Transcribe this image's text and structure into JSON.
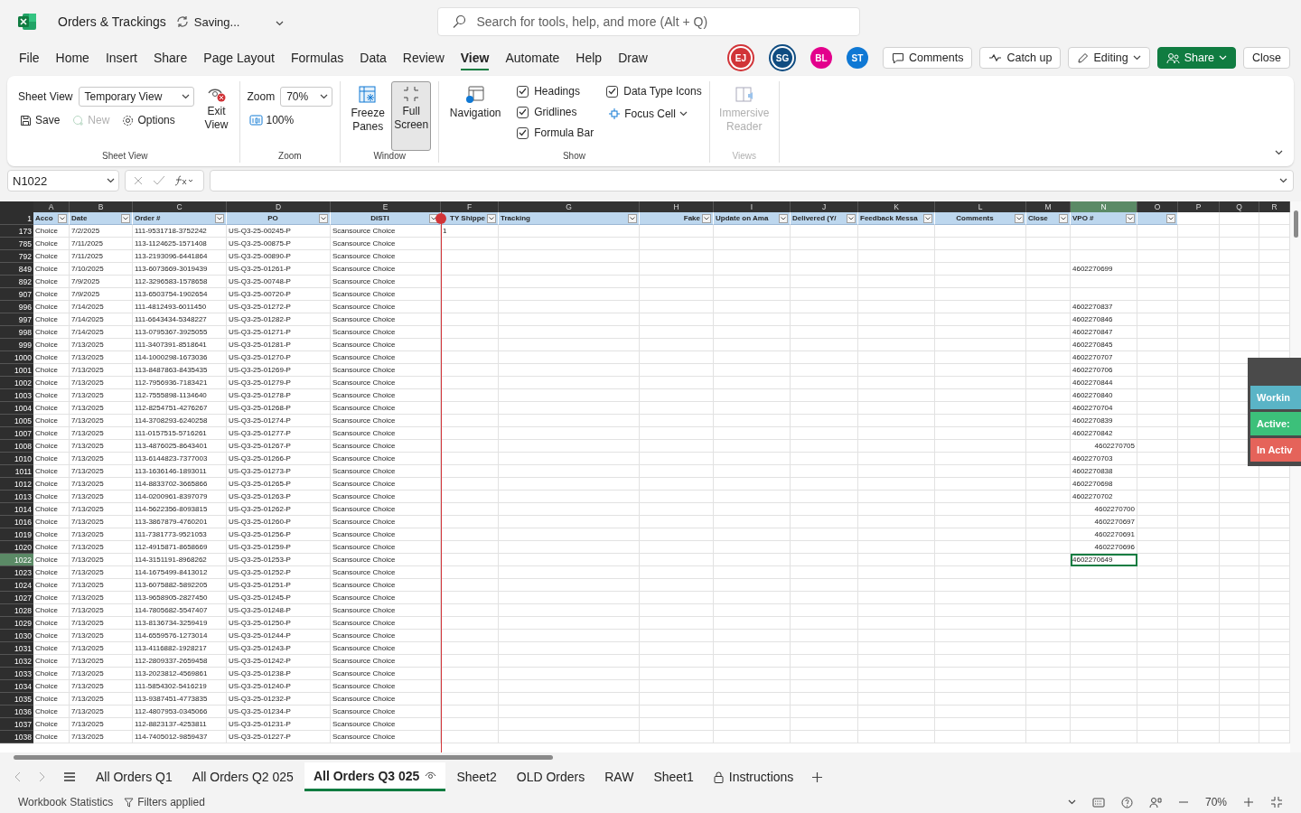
{
  "title_bar": {
    "file_name": "Orders & Trackings",
    "save_status": "Saving...",
    "search": {
      "placeholder": "Search for tools, help, and more (Alt + Q)"
    }
  },
  "menu": {
    "tabs": [
      {
        "label": "File",
        "selected": false
      },
      {
        "label": "Home",
        "selected": false
      },
      {
        "label": "Insert",
        "selected": false
      },
      {
        "label": "Share",
        "selected": false
      },
      {
        "label": "Page Layout",
        "selected": false
      },
      {
        "label": "Formulas",
        "selected": false
      },
      {
        "label": "Data",
        "selected": false
      },
      {
        "label": "Review",
        "selected": false
      },
      {
        "label": "View",
        "selected": true
      },
      {
        "label": "Automate",
        "selected": false
      },
      {
        "label": "Help",
        "selected": false
      },
      {
        "label": "Draw",
        "selected": false
      }
    ],
    "avatars": [
      {
        "initials": "EJ",
        "color": "#d13438",
        "ring": true
      },
      {
        "initials": "SG",
        "color": "#0f4c81",
        "ring": true
      },
      {
        "initials": "BL",
        "color": "#e3008c",
        "ring": false
      },
      {
        "initials": "ST",
        "color": "#0f78d4",
        "ring": false
      }
    ],
    "buttons": [
      {
        "label": "Comments",
        "kind": "comments"
      },
      {
        "label": "Catch up",
        "kind": "catchup"
      },
      {
        "label": "Editing",
        "kind": "editing"
      },
      {
        "label": "Share",
        "kind": "share"
      },
      {
        "label": "Close",
        "kind": "close"
      }
    ]
  },
  "ribbon": {
    "sheet_view": {
      "label": "Sheet View",
      "view": "Temporary View",
      "save": "Save",
      "new": {
        "label": "New",
        "disabled": true
      },
      "options": "Options",
      "exit": "Exit View",
      "group": "Sheet View"
    },
    "zoom": {
      "label": "Zoom",
      "value": "70%",
      "reset": "100%",
      "group": "Zoom"
    },
    "window": {
      "freeze": "Freeze Panes",
      "full_screen": {
        "label": "Full Screen",
        "selected": true
      },
      "group": "Window"
    },
    "show": {
      "navigation": "Navigation",
      "checks": [
        {
          "label": "Headings",
          "checked": true
        },
        {
          "label": "Gridlines",
          "checked": true
        },
        {
          "label": "Formula Bar",
          "checked": true
        },
        {
          "label": "Data Type Icons",
          "checked": true
        }
      ],
      "focus_cell": "Focus Cell",
      "group": "Show"
    },
    "views": {
      "immersive": {
        "label": "Immersive Reader",
        "disabled": true
      },
      "group": "Views"
    }
  },
  "formula_bar": {
    "name_box": "N1022"
  },
  "sheet": {
    "columns": [
      {
        "letter": "A",
        "header": "Acco",
        "filter": true,
        "selected": false
      },
      {
        "letter": "B",
        "header": "Date",
        "filter": true,
        "selected": false
      },
      {
        "letter": "C",
        "header": "Order #",
        "filter": true,
        "selected": false
      },
      {
        "letter": "D",
        "header": "PO",
        "filter": true,
        "selected": false
      },
      {
        "letter": "E",
        "header": "DISTI",
        "filter": true,
        "selected": false
      },
      {
        "letter": "F",
        "header": "TY Shippe",
        "filter": true,
        "selected": false,
        "color": "#d13438"
      },
      {
        "letter": "G",
        "header": "Tracking",
        "filter": true,
        "selected": false
      },
      {
        "letter": "H",
        "header": "Fake",
        "filter": true,
        "selected": false
      },
      {
        "letter": "I",
        "header": "Update on Ama",
        "filter": true,
        "selected": false
      },
      {
        "letter": "J",
        "header": "Delivered (Y/",
        "filter": true,
        "selected": false
      },
      {
        "letter": "K",
        "header": "Feedback Messa",
        "filter": true,
        "selected": false
      },
      {
        "letter": "L",
        "header": "Comments",
        "filter": true,
        "selected": false
      },
      {
        "letter": "M",
        "header": "Close",
        "filter": true,
        "selected": false
      },
      {
        "letter": "N",
        "header": "VPO #",
        "filter": true,
        "selected": true
      },
      {
        "letter": "O",
        "filter": true,
        "selected": false
      },
      {
        "letter": "P",
        "filter": false,
        "selected": false
      },
      {
        "letter": "Q",
        "filter": false,
        "selected": false
      },
      {
        "letter": "R",
        "filter": false,
        "selected": false
      }
    ],
    "header_row": "1",
    "rows": [
      {
        "num": "173",
        "selected": false,
        "cells": {
          "A": "Choice",
          "B": "7/2/2025",
          "C": "111-9531718-3752242",
          "D": "US-Q3-25-00245-P",
          "E": "Scansource Choice",
          "F": "1"
        }
      },
      {
        "num": "785",
        "selected": false,
        "cells": {
          "A": "Choice",
          "B": "7/11/2025",
          "C": "113-1124625-1571408",
          "D": "US-Q3-25-00875-P",
          "E": "Scansource Choice"
        }
      },
      {
        "num": "792",
        "selected": false,
        "cells": {
          "A": "Choice",
          "B": "7/11/2025",
          "C": "113-2193096-6441864",
          "D": "US-Q3-25-00890-P",
          "E": "Scansource Choice"
        }
      },
      {
        "num": "849",
        "selected": false,
        "cells": {
          "A": "Choice",
          "B": "7/10/2025",
          "C": "113-6073669-3019439",
          "D": "US-Q3-25-01261-P",
          "E": "Scansource Choice",
          "N": "4602270699"
        }
      },
      {
        "num": "892",
        "selected": false,
        "cells": {
          "A": "Choice",
          "B": "7/9/2025",
          "C": "112-3296583-1578658",
          "D": "US-Q3-25-00748-P",
          "E": "Scansource Choice"
        }
      },
      {
        "num": "907",
        "selected": false,
        "cells": {
          "A": "Choice",
          "B": "7/9/2025",
          "C": "113-6503754-1902654",
          "D": "US-Q3-25-00720-P",
          "E": "Scansource Choice"
        }
      },
      {
        "num": "996",
        "selected": false,
        "cells": {
          "A": "Choice",
          "B": "7/14/2025",
          "C": "111-4812493-6011450",
          "D": "US-Q3-25-01272-P",
          "E": "Scansource Choice",
          "N": "4602270837"
        }
      },
      {
        "num": "997",
        "selected": false,
        "cells": {
          "A": "Choice",
          "B": "7/14/2025",
          "C": "111-6643434-5348227",
          "D": "US-Q3-25-01282-P",
          "E": "Scansource Choice",
          "N": "4602270846"
        }
      },
      {
        "num": "998",
        "selected": false,
        "cells": {
          "A": "Choice",
          "B": "7/14/2025",
          "C": "113-0795367-3925055",
          "D": "US-Q3-25-01271-P",
          "E": "Scansource Choice",
          "N": "4602270847"
        }
      },
      {
        "num": "999",
        "selected": false,
        "cells": {
          "A": "Choice",
          "B": "7/13/2025",
          "C": "111-3407391-8518641",
          "D": "US-Q3-25-01281-P",
          "E": "Scansource Choice",
          "N": "4602270845"
        }
      },
      {
        "num": "1000",
        "selected": false,
        "cells": {
          "A": "Choice",
          "B": "7/13/2025",
          "C": "114-1000298-1673036",
          "D": "US-Q3-25-01270-P",
          "E": "Scansource Choice",
          "N": "4602270707"
        }
      },
      {
        "num": "1001",
        "selected": false,
        "cells": {
          "A": "Choice",
          "B": "7/13/2025",
          "C": "113-8487863-8435435",
          "D": "US-Q3-25-01269-P",
          "E": "Scansource Choice",
          "N": "4602270706"
        }
      },
      {
        "num": "1002",
        "selected": false,
        "cells": {
          "A": "Choice",
          "B": "7/13/2025",
          "C": "112-7956936-7183421",
          "D": "US-Q3-25-01279-P",
          "E": "Scansource Choice",
          "N": "4602270844"
        }
      },
      {
        "num": "1003",
        "selected": false,
        "cells": {
          "A": "Choice",
          "B": "7/13/2025",
          "C": "112-7555898-1134640",
          "D": "US-Q3-25-01278-P",
          "E": "Scansource Choice",
          "N": "4602270840"
        }
      },
      {
        "num": "1004",
        "selected": false,
        "cells": {
          "A": "Choice",
          "B": "7/13/2025",
          "C": "112-8254751-4276267",
          "D": "US-Q3-25-01268-P",
          "E": "Scansource Choice",
          "N": "4602270704"
        }
      },
      {
        "num": "1005",
        "selected": false,
        "cells": {
          "A": "Choice",
          "B": "7/13/2025",
          "C": "114-3708293-6240258",
          "D": "US-Q3-25-01274-P",
          "E": "Scansource Choice",
          "N": "4602270839"
        }
      },
      {
        "num": "1007",
        "selected": false,
        "cells": {
          "A": "Choice",
          "B": "7/13/2025",
          "C": "111-0157515-5716261",
          "D": "US-Q3-25-01277-P",
          "E": "Scansource Choice",
          "N": "4602270842"
        }
      },
      {
        "num": "1008",
        "selected": false,
        "n_right": true,
        "cells": {
          "A": "Choice",
          "B": "7/13/2025",
          "C": "113-4876025-8643401",
          "D": "US-Q3-25-01267-P",
          "E": "Scansource Choice",
          "N": "4602270705"
        }
      },
      {
        "num": "1010",
        "selected": false,
        "cells": {
          "A": "Choice",
          "B": "7/13/2025",
          "C": "113-6144823-7377003",
          "D": "US-Q3-25-01266-P",
          "E": "Scansource Choice",
          "N": "4602270703"
        }
      },
      {
        "num": "1011",
        "selected": false,
        "cells": {
          "A": "Choice",
          "B": "7/13/2025",
          "C": "113-1636146-1893011",
          "D": "US-Q3-25-01273-P",
          "E": "Scansource Choice",
          "N": "4602270838"
        }
      },
      {
        "num": "1012",
        "selected": false,
        "cells": {
          "A": "Choice",
          "B": "7/13/2025",
          "C": "114-8833702-3665866",
          "D": "US-Q3-25-01265-P",
          "E": "Scansource Choice",
          "N": "4602270698"
        }
      },
      {
        "num": "1013",
        "selected": false,
        "cells": {
          "A": "Choice",
          "B": "7/13/2025",
          "C": "114-0200961-8397079",
          "D": "US-Q3-25-01263-P",
          "E": "Scansource Choice",
          "N": "4602270702"
        }
      },
      {
        "num": "1014",
        "selected": false,
        "n_right": true,
        "cells": {
          "A": "Choice",
          "B": "7/13/2025",
          "C": "114-5622356-8093815",
          "D": "US-Q3-25-01262-P",
          "E": "Scansource Choice",
          "N": "4602270700"
        }
      },
      {
        "num": "1016",
        "selected": false,
        "n_right": true,
        "cells": {
          "A": "Choice",
          "B": "7/13/2025",
          "C": "113-3867879-4760201",
          "D": "US-Q3-25-01260-P",
          "E": "Scansource Choice",
          "N": "4602270697"
        }
      },
      {
        "num": "1019",
        "selected": false,
        "n_right": true,
        "cells": {
          "A": "Choice",
          "B": "7/13/2025",
          "C": "111-7381773-9521053",
          "D": "US-Q3-25-01256-P",
          "E": "Scansource Choice",
          "N": "4602270691"
        }
      },
      {
        "num": "1020",
        "selected": false,
        "n_right": true,
        "cells": {
          "A": "Choice",
          "B": "7/13/2025",
          "C": "112-4915871-8658669",
          "D": "US-Q3-25-01259-P",
          "E": "Scansource Choice",
          "N": "4602270696"
        }
      },
      {
        "num": "1022",
        "selected": true,
        "cells": {
          "A": "Choice",
          "B": "7/13/2025",
          "C": "114-3151191-8968262",
          "D": "US-Q3-25-01253-P",
          "E": "Scansource Choice",
          "N": "4602270649"
        }
      },
      {
        "num": "1023",
        "selected": false,
        "cells": {
          "A": "Choice",
          "B": "7/13/2025",
          "C": "114-1675499-8413012",
          "D": "US-Q3-25-01252-P",
          "E": "Scansource Choice"
        }
      },
      {
        "num": "1024",
        "selected": false,
        "cells": {
          "A": "Choice",
          "B": "7/13/2025",
          "C": "113-6075882-5892205",
          "D": "US-Q3-25-01251-P",
          "E": "Scansource Choice"
        }
      },
      {
        "num": "1027",
        "selected": false,
        "cells": {
          "A": "Choice",
          "B": "7/13/2025",
          "C": "113-9658905-2827450",
          "D": "US-Q3-25-01245-P",
          "E": "Scansource Choice"
        }
      },
      {
        "num": "1028",
        "selected": false,
        "cells": {
          "A": "Choice",
          "B": "7/13/2025",
          "C": "114-7805682-5547407",
          "D": "US-Q3-25-01248-P",
          "E": "Scansource Choice"
        }
      },
      {
        "num": "1029",
        "selected": false,
        "cells": {
          "A": "Choice",
          "B": "7/13/2025",
          "C": "113-8136734-3259419",
          "D": "US-Q3-25-01250-P",
          "E": "Scansource Choice"
        }
      },
      {
        "num": "1030",
        "selected": false,
        "cells": {
          "A": "Choice",
          "B": "7/13/2025",
          "C": "114-6559576-1273014",
          "D": "US-Q3-25-01244-P",
          "E": "Scansource Choice"
        }
      },
      {
        "num": "1031",
        "selected": false,
        "cells": {
          "A": "Choice",
          "B": "7/13/2025",
          "C": "113-4116882-1928217",
          "D": "US-Q3-25-01243-P",
          "E": "Scansource Choice"
        }
      },
      {
        "num": "1032",
        "selected": false,
        "cells": {
          "A": "Choice",
          "B": "7/13/2025",
          "C": "112-2809337-2659458",
          "D": "US-Q3-25-01242-P",
          "E": "Scansource Choice"
        }
      },
      {
        "num": "1033",
        "selected": false,
        "cells": {
          "A": "Choice",
          "B": "7/13/2025",
          "C": "113-2023812-4569861",
          "D": "US-Q3-25-01238-P",
          "E": "Scansource Choice"
        }
      },
      {
        "num": "1034",
        "selected": false,
        "cells": {
          "A": "Choice",
          "B": "7/13/2025",
          "C": "111-5854302-5416219",
          "D": "US-Q3-25-01240-P",
          "E": "Scansource Choice"
        }
      },
      {
        "num": "1035",
        "selected": false,
        "cells": {
          "A": "Choice",
          "B": "7/13/2025",
          "C": "113-9387451-4773835",
          "D": "US-Q3-25-01232-P",
          "E": "Scansource Choice"
        }
      },
      {
        "num": "1036",
        "selected": false,
        "cells": {
          "A": "Choice",
          "B": "7/13/2025",
          "C": "112-4807953-0345066",
          "D": "US-Q3-25-01234-P",
          "E": "Scansource Choice"
        }
      },
      {
        "num": "1037",
        "selected": false,
        "cells": {
          "A": "Choice",
          "B": "7/13/2025",
          "C": "112-8823137-4253811",
          "D": "US-Q3-25-01231-P",
          "E": "Scansource Choice"
        }
      },
      {
        "num": "1038",
        "selected": false,
        "cells": {
          "A": "Choice",
          "B": "7/13/2025",
          "C": "114-7405012-9859437",
          "D": "US-Q3-25-01227-P",
          "E": "Scansource Choice"
        }
      }
    ]
  },
  "status_panel": {
    "items": [
      {
        "label": "Workin",
        "color": "#5ab4c6"
      },
      {
        "label": "Active:",
        "color": "#3cc07a"
      },
      {
        "label": "In Activ",
        "color": "#e5635a"
      }
    ]
  },
  "sheet_tabs": [
    {
      "label": "All Orders Q1",
      "selected": false,
      "kind": "plain"
    },
    {
      "label": "All Orders Q2 025",
      "selected": false,
      "kind": "plain"
    },
    {
      "label": "All Orders Q3 025",
      "selected": true,
      "kind": "viewed"
    },
    {
      "label": "Sheet2",
      "selected": false,
      "kind": "plain"
    },
    {
      "label": "OLD Orders",
      "selected": false,
      "kind": "plain"
    },
    {
      "label": "RAW",
      "selected": false,
      "kind": "plain"
    },
    {
      "label": "Sheet1",
      "selected": false,
      "kind": "plain"
    },
    {
      "label": "Instructions",
      "selected": false,
      "kind": "locked"
    }
  ],
  "status_bar": {
    "statistics": "Workbook Statistics",
    "filters": "Filters applied",
    "zoom": "70%"
  }
}
